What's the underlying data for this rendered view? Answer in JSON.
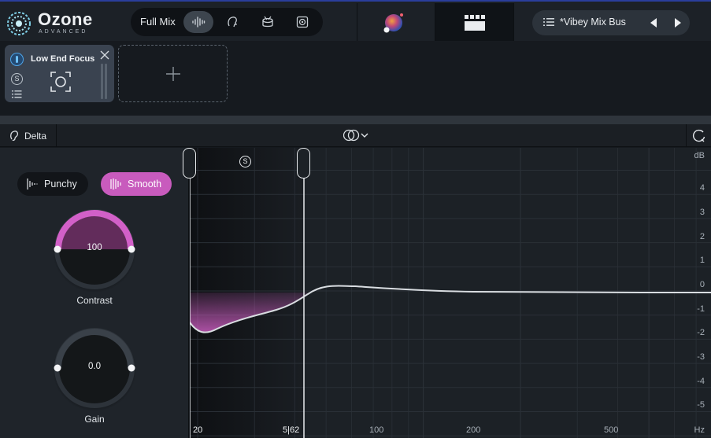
{
  "app": {
    "logo_name": "Ozone",
    "logo_sub": "ADVANCED"
  },
  "modebar": {
    "label": "Full Mix",
    "buttons": [
      "waveform-icon",
      "voice-icon",
      "drum-icon",
      "speaker-icon"
    ],
    "active_index": 0
  },
  "preset": {
    "name": "*Vibey Mix Bus"
  },
  "modules": [
    {
      "name": "Low End Focus",
      "enabled": true
    }
  ],
  "toolbar": {
    "delta_label": "Delta"
  },
  "mode_toggle": {
    "punchy_label": "Punchy",
    "smooth_label": "Smooth",
    "selected": "Smooth"
  },
  "knobs": {
    "contrast": {
      "label": "Contrast",
      "value": "100",
      "level": 1.0
    },
    "gain": {
      "label": "Gain",
      "value": "0.0",
      "level": 0.5
    }
  },
  "graph": {
    "db_unit": "dB",
    "db_ticks": [
      "4",
      "3",
      "2",
      "1",
      "0",
      "-1",
      "-2",
      "-3",
      "-4",
      "-5"
    ],
    "hz_unit": "Hz",
    "hz_ticks": [
      "20",
      "100",
      "200",
      "500"
    ],
    "band_low": "20",
    "band_high": "5|62",
    "colors": {
      "accent": "#c85bbd",
      "curve": "#d9dde1",
      "grid": "#2a3037"
    }
  }
}
